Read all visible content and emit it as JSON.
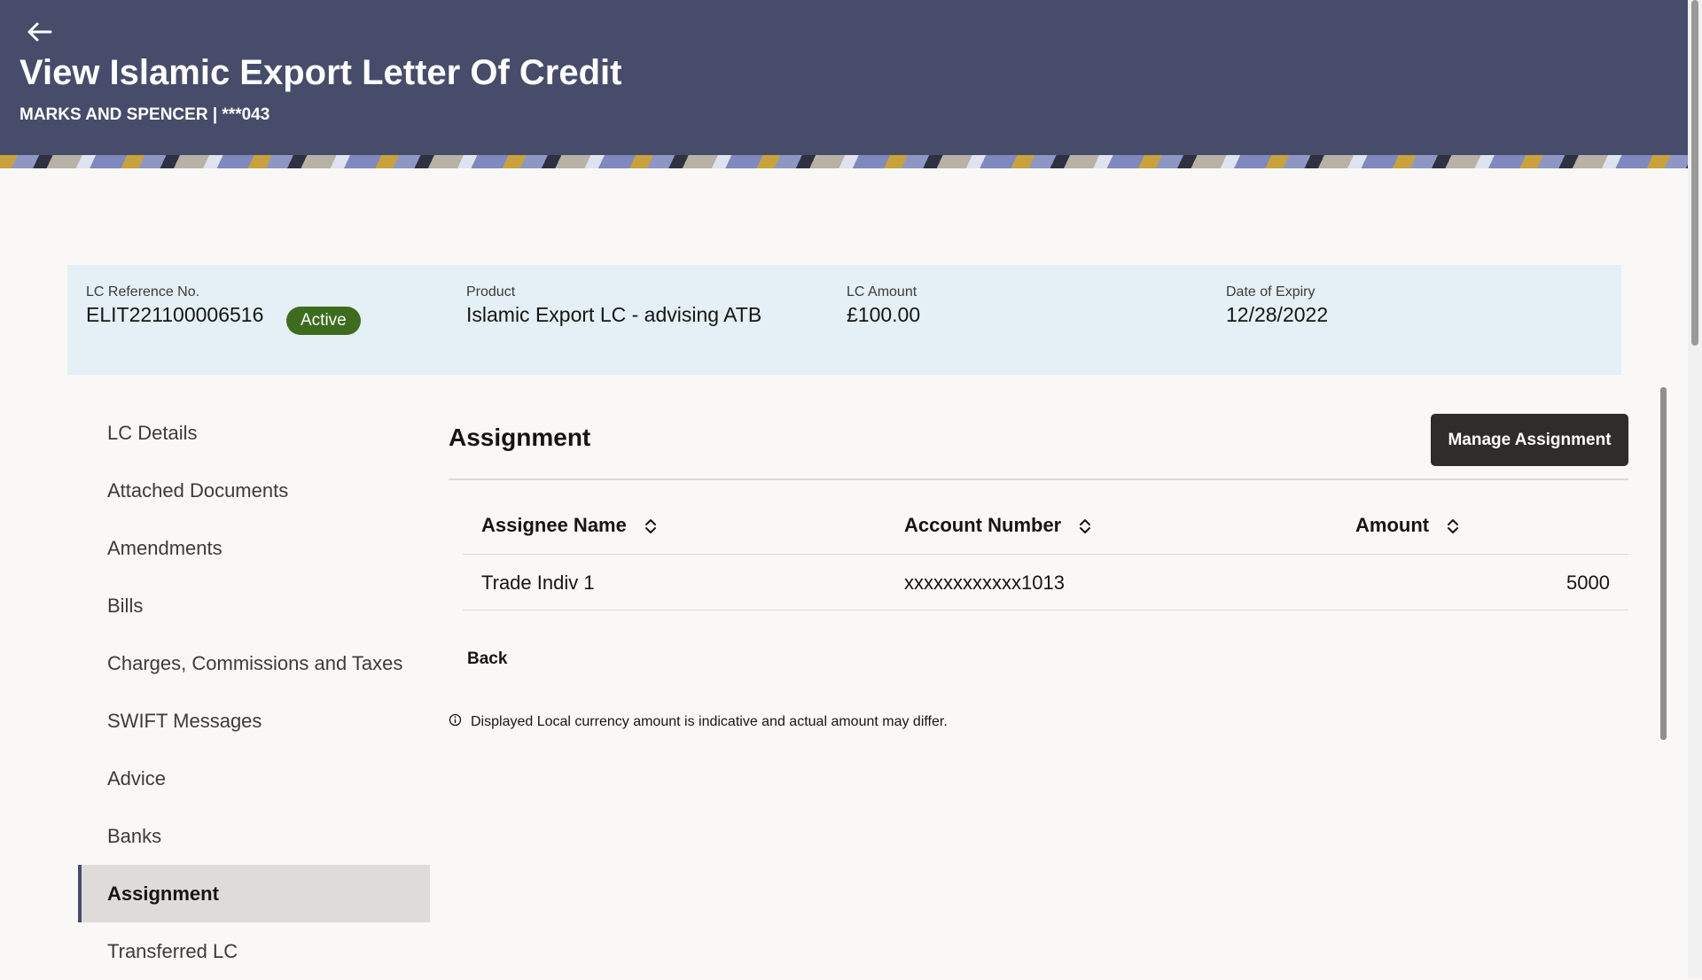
{
  "header": {
    "title": "View Islamic Export Letter Of Credit",
    "subtitle": "MARKS AND SPENCER | ***043"
  },
  "summary": {
    "reference_label": "LC Reference No.",
    "reference_value": "ELIT221100006516",
    "status": "Active",
    "product_label": "Product",
    "product_value": "Islamic Export LC - advising ATB",
    "amount_label": "LC Amount",
    "amount_value": "£100.00",
    "expiry_label": "Date of Expiry",
    "expiry_value": "12/28/2022"
  },
  "sidenav": {
    "items": [
      {
        "label": "LC Details"
      },
      {
        "label": "Attached Documents"
      },
      {
        "label": "Amendments"
      },
      {
        "label": "Bills"
      },
      {
        "label": "Charges, Commissions and Taxes"
      },
      {
        "label": "SWIFT Messages"
      },
      {
        "label": "Advice"
      },
      {
        "label": "Banks"
      },
      {
        "label": "Assignment"
      },
      {
        "label": "Transferred LC"
      }
    ],
    "active_index": 8
  },
  "main": {
    "section_title": "Assignment",
    "manage_button": "Manage Assignment",
    "table": {
      "columns": [
        "Assignee Name",
        "Account Number",
        "Amount"
      ],
      "rows": [
        {
          "assignee": "Trade Indiv 1",
          "account": "xxxxxxxxxxxx1013",
          "amount": "5000"
        }
      ]
    },
    "back_label": "Back",
    "disclaimer": "Displayed Local currency amount is indicative and actual amount may differ."
  },
  "icons": {
    "back": "arrow-left-icon",
    "sort": "sort-up-down-icon",
    "info": "info-circle-icon"
  },
  "colors": {
    "header_bg": "#464c6a",
    "summary_bg": "#e4f0f5",
    "status_green": "#3d6c1f",
    "button_dark": "#2f2c29",
    "active_nav_bg": "#dedbd8"
  }
}
